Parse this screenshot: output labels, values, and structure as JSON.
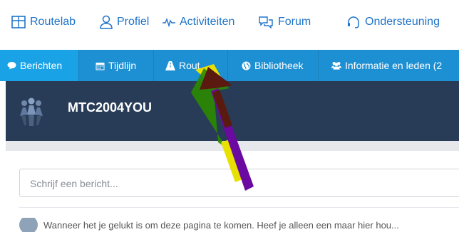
{
  "top_nav": {
    "items": [
      {
        "label": "Routelab",
        "icon": "map-grid-icon"
      },
      {
        "label": "Profiel",
        "icon": "user-icon"
      },
      {
        "label": "Activiteiten",
        "icon": "pulse-icon"
      },
      {
        "label": "Forum",
        "icon": "chat-bubbles-icon"
      },
      {
        "label": "Ondersteuning",
        "icon": "headset-icon"
      }
    ]
  },
  "tabs": [
    {
      "label": "Berichten",
      "icon": "comment-icon",
      "active": true
    },
    {
      "label": "Tijdlijn",
      "icon": "calendar-icon",
      "active": false
    },
    {
      "label": "Rout",
      "icon": "road-icon",
      "active": false
    },
    {
      "label": "Bibliotheek",
      "icon": "globe-icon",
      "active": false
    },
    {
      "label": "Informatie en leden (2",
      "icon": "users-icon",
      "active": false
    }
  ],
  "group": {
    "title": "MTC2004YOU"
  },
  "compose": {
    "placeholder": "Schrijf een bericht..."
  },
  "post": {
    "text": "Wanneer het je gelukt is om deze pagina te komen. Heef je alleen een maar hier hou..."
  },
  "colors": {
    "link_blue": "#1f74c9",
    "tab_bar": "#1d8fd3",
    "tab_active": "#1aa2e6",
    "banner": "#283c58"
  }
}
